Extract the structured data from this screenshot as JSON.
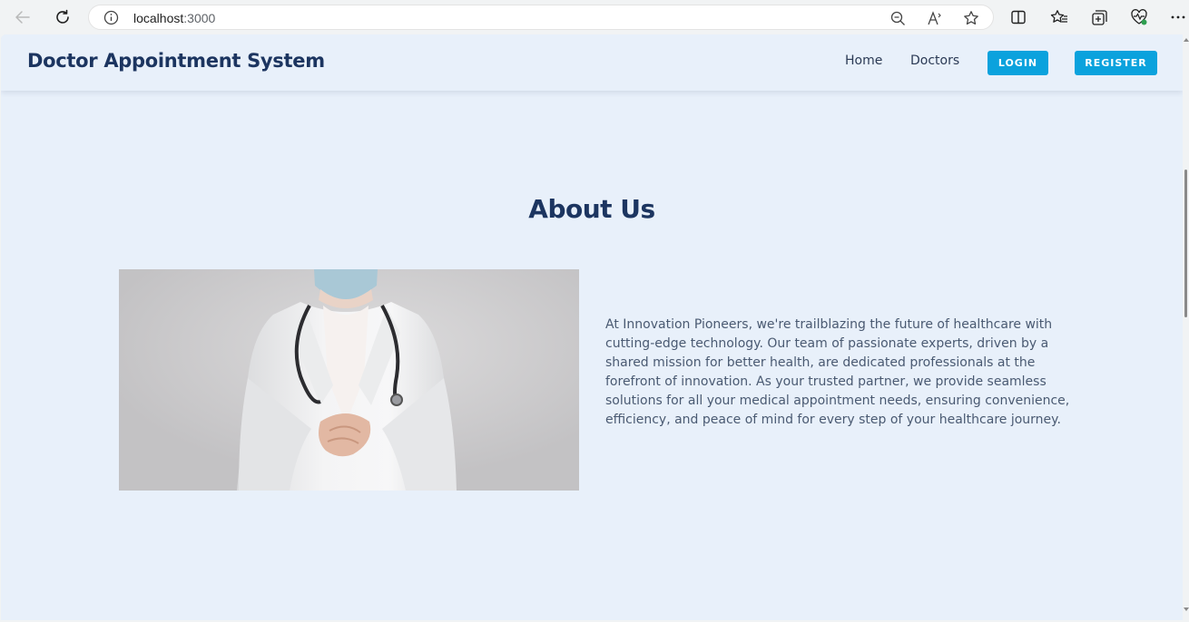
{
  "browser": {
    "url_host": "localhost",
    "url_port": ":3000"
  },
  "header": {
    "brand": "Doctor Appointment System",
    "nav": {
      "home": "Home",
      "doctors": "Doctors"
    },
    "login_label": "LOGIN",
    "register_label": "REGISTER"
  },
  "about": {
    "title": "About Us",
    "text": "At Innovation Pioneers, we're trailblazing the future of healthcare with cutting-edge technology. Our team of passionate experts, driven by a shared mission for better health, are dedicated professionals at the forefront of innovation. As your trusted partner, we provide seamless solutions for all your medical appointment needs, ensuring convenience, efficiency, and peace of mind for every step of your healthcare journey."
  },
  "colors": {
    "page_bg": "#e8f0fa",
    "brand_text": "#1c3560",
    "accent_button": "#0ba2dd",
    "body_text": "#4a5a72"
  },
  "icons": [
    "back-arrow-icon",
    "reload-icon",
    "info-icon",
    "zoom-out-icon",
    "read-aloud-icon",
    "favorite-star-icon",
    "split-screen-icon",
    "favorites-icon",
    "collections-icon",
    "browser-essentials-icon",
    "more-icon"
  ]
}
